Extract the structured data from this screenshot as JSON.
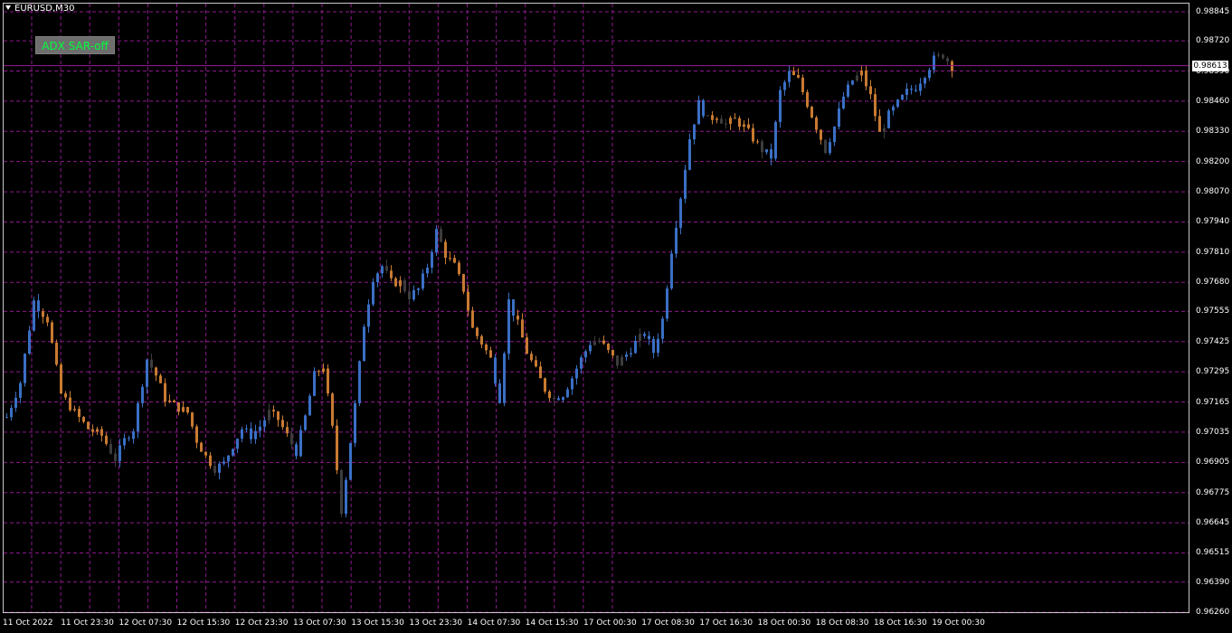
{
  "window": {
    "symbol": "EURUSD,M30"
  },
  "indicator_button": {
    "label": "ADX SAR-off",
    "text_color": "#00ff3c"
  },
  "colors": {
    "background": "#000000",
    "grid": "#8b1a8b",
    "bull": "#3a6fc4",
    "bear": "#c87a32",
    "neutral": "#3c3c3c",
    "bid_line": "#9a1a9a"
  },
  "price_axis": {
    "ticks": [
      "0.98845",
      "0.98720",
      "0.98590",
      "0.98460",
      "0.98330",
      "0.98200",
      "0.98070",
      "0.97940",
      "0.97810",
      "0.97680",
      "0.97555",
      "0.97425",
      "0.97295",
      "0.97165",
      "0.97035",
      "0.96905",
      "0.96775",
      "0.96645",
      "0.96515",
      "0.96390",
      "0.96260"
    ]
  },
  "current_price": "0.98613",
  "time_axis": {
    "ticks": [
      "11 Oct 2022",
      "11 Oct 23:30",
      "12 Oct 07:30",
      "12 Oct 15:30",
      "12 Oct 23:30",
      "13 Oct 07:30",
      "13 Oct 15:30",
      "13 Oct 23:30",
      "14 Oct 07:30",
      "14 Oct 15:30",
      "17 Oct 00:30",
      "17 Oct 08:30",
      "17 Oct 16:30",
      "18 Oct 00:30",
      "18 Oct 08:30",
      "18 Oct 16:30",
      "19 Oct 00:30"
    ]
  },
  "chart_data": {
    "type": "candlestick",
    "symbol": "EURUSD",
    "timeframe": "M30",
    "ylim": [
      0.9626,
      0.98845
    ],
    "path": [
      [
        0,
        0.971
      ],
      [
        3,
        0.9725
      ],
      [
        6,
        0.976
      ],
      [
        9,
        0.9752
      ],
      [
        12,
        0.972
      ],
      [
        15,
        0.9712
      ],
      [
        18,
        0.9705
      ],
      [
        21,
        0.9702
      ],
      [
        24,
        0.9692
      ],
      [
        26,
        0.97
      ],
      [
        28,
        0.9705
      ],
      [
        31,
        0.9735
      ],
      [
        33,
        0.9728
      ],
      [
        35,
        0.9718
      ],
      [
        37,
        0.9715
      ],
      [
        40,
        0.9712
      ],
      [
        42,
        0.97
      ],
      [
        44,
        0.9693
      ],
      [
        46,
        0.9688
      ],
      [
        48,
        0.969
      ],
      [
        50,
        0.9698
      ],
      [
        52,
        0.9705
      ],
      [
        54,
        0.9702
      ],
      [
        56,
        0.9706
      ],
      [
        58,
        0.9712
      ],
      [
        60,
        0.9709
      ],
      [
        62,
        0.9702
      ],
      [
        64,
        0.9695
      ],
      [
        66,
        0.971
      ],
      [
        68,
        0.9728
      ],
      [
        70,
        0.9732
      ],
      [
        72,
        0.9705
      ],
      [
        74,
        0.967
      ],
      [
        75,
        0.9684
      ],
      [
        77,
        0.9715
      ],
      [
        79,
        0.975
      ],
      [
        81,
        0.977
      ],
      [
        83,
        0.9775
      ],
      [
        85,
        0.9768
      ],
      [
        87,
        0.9768
      ],
      [
        89,
        0.9762
      ],
      [
        91,
        0.9765
      ],
      [
        93,
        0.9775
      ],
      [
        95,
        0.979
      ],
      [
        97,
        0.978
      ],
      [
        99,
        0.9775
      ],
      [
        101,
        0.9765
      ],
      [
        103,
        0.9748
      ],
      [
        105,
        0.9742
      ],
      [
        107,
        0.9735
      ],
      [
        109,
        0.9718
      ],
      [
        111,
        0.976
      ],
      [
        113,
        0.975
      ],
      [
        115,
        0.9738
      ],
      [
        117,
        0.973
      ],
      [
        119,
        0.9722
      ],
      [
        121,
        0.9718
      ],
      [
        123,
        0.972
      ],
      [
        125,
        0.9727
      ],
      [
        127,
        0.9735
      ],
      [
        129,
        0.9742
      ],
      [
        131,
        0.9743
      ],
      [
        133,
        0.9738
      ],
      [
        135,
        0.9733
      ],
      [
        137,
        0.9737
      ],
      [
        139,
        0.9742
      ],
      [
        141,
        0.9746
      ],
      [
        143,
        0.9738
      ],
      [
        145,
        0.9752
      ],
      [
        147,
        0.9782
      ],
      [
        149,
        0.9805
      ],
      [
        151,
        0.983
      ],
      [
        153,
        0.9845
      ],
      [
        155,
        0.9838
      ],
      [
        157,
        0.984
      ],
      [
        159,
        0.9836
      ],
      [
        161,
        0.9838
      ],
      [
        163,
        0.9835
      ],
      [
        165,
        0.983
      ],
      [
        167,
        0.9825
      ],
      [
        169,
        0.9822
      ],
      [
        171,
        0.985
      ],
      [
        173,
        0.9858
      ],
      [
        175,
        0.9855
      ],
      [
        177,
        0.9845
      ],
      [
        179,
        0.9835
      ],
      [
        181,
        0.9825
      ],
      [
        183,
        0.9835
      ],
      [
        185,
        0.9848
      ],
      [
        187,
        0.9855
      ],
      [
        189,
        0.9858
      ],
      [
        191,
        0.9848
      ],
      [
        193,
        0.9832
      ],
      [
        195,
        0.984
      ],
      [
        197,
        0.9845
      ],
      [
        199,
        0.985
      ],
      [
        201,
        0.9852
      ],
      [
        203,
        0.9858
      ],
      [
        205,
        0.9864
      ],
      [
        207,
        0.9866
      ],
      [
        209,
        0.9861
      ]
    ],
    "x_index_to_time": {
      "start": "11 Oct 2022",
      "bar_interval_minutes": 30
    }
  }
}
